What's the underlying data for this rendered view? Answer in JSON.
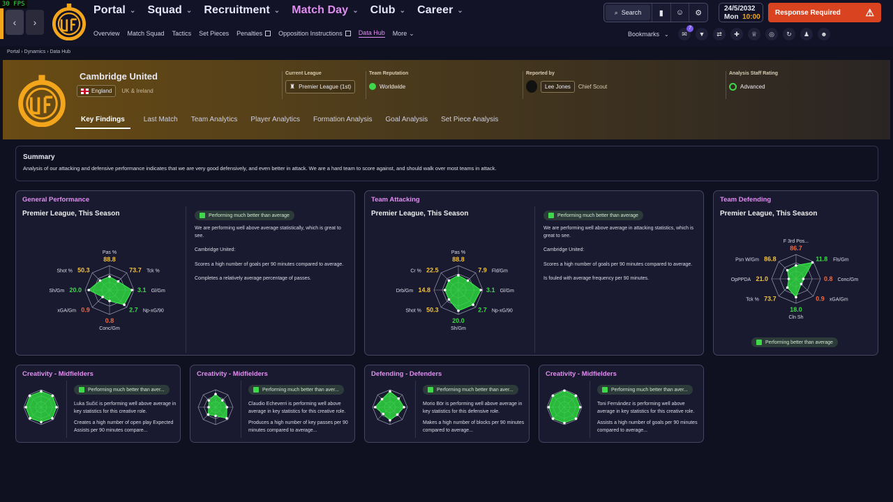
{
  "fps": "30 FPS",
  "nav": {
    "main": [
      "Portal",
      "Squad",
      "Recruitment",
      "Match Day",
      "Club",
      "Career"
    ],
    "active": "Match Day",
    "sub": [
      "Overview",
      "Match Squad",
      "Tactics",
      "Set Pieces",
      "Penalties",
      "Opposition Instructions",
      "Data Hub",
      "More"
    ],
    "sub_active": "Data Hub",
    "search_label": "Search",
    "date": "24/5/2032",
    "day": "Mon",
    "time": "10:00",
    "response": "Response Required",
    "bookmarks": "Bookmarks",
    "notif_count": "7"
  },
  "breadcrumb": [
    "Portal",
    "Dynamics",
    "Data Hub"
  ],
  "team": {
    "name": "Cambridge United",
    "nation": "England",
    "region": "UK & Ireland",
    "league_label": "Current League",
    "league": "Premier League (1st)",
    "rep_label": "Team Reputation",
    "rep": "Worldwide",
    "reported_label": "Reported by",
    "reporter": "Lee Jones",
    "reporter_role": "Chief Scout",
    "rating_label": "Analysis Staff Rating",
    "rating": "Advanced"
  },
  "tabs": [
    "Key Findings",
    "Last Match",
    "Team Analytics",
    "Player Analytics",
    "Formation Analysis",
    "Goal Analysis",
    "Set Piece Analysis"
  ],
  "summary": {
    "title": "Summary",
    "text": "Analysis of our attacking and defensive performance indicates that we are very good defensively, and even better in attack. We are a hard team to score against, and should walk over most teams in attack."
  },
  "colors": {
    "accent": "#e08ef0",
    "good": "#3ed84a",
    "mid": "#f3c23a",
    "bad": "#ec6a45",
    "brand": "#f3a51b"
  },
  "panels": [
    {
      "title": "General Performance",
      "sub": "Premier League, This Season",
      "pill": "Performing much better than average",
      "lines": [
        "We are performing well above average statistically, which is great to see.",
        "Cambridge United:",
        "Scores a high number of goals per 90 minutes compared to average.",
        "Completes a relatively average percentage of passes."
      ],
      "chart_data": {
        "type": "radar",
        "axes": [
          {
            "label": "Pas %",
            "value": "88.8",
            "level": 0.55,
            "color": "mid"
          },
          {
            "label": "Tck %",
            "value": "73.7",
            "level": 0.5,
            "color": "mid"
          },
          {
            "label": "Gl/Gm",
            "value": "3.1",
            "level": 0.92,
            "color": "good"
          },
          {
            "label": "Np-xG/90",
            "value": "2.7",
            "level": 0.85,
            "color": "good"
          },
          {
            "label": "Conc/Gm",
            "value": "0.8",
            "level": 0.45,
            "color": "bad"
          },
          {
            "label": "xGA/Gm",
            "value": "0.9",
            "level": 0.4,
            "color": "bad"
          },
          {
            "label": "Sh/Gm",
            "value": "20.0",
            "level": 0.85,
            "color": "good"
          },
          {
            "label": "Shot %",
            "value": "50.3",
            "level": 0.55,
            "color": "mid"
          }
        ]
      }
    },
    {
      "title": "Team Attacking",
      "sub": "Premier League, This Season",
      "pill": "Performing much better than average",
      "lines": [
        "We are performing well above average in attacking statistics, which is great to see.",
        "Cambridge United:",
        "Scores a high number of goals per 90 minutes compared to average.",
        "Is fouled with average frequency per 90 minutes."
      ],
      "chart_data": {
        "type": "radar",
        "axes": [
          {
            "label": "Pas %",
            "value": "88.8",
            "level": 0.6,
            "color": "mid"
          },
          {
            "label": "Fld/Gm",
            "value": "7.9",
            "level": 0.55,
            "color": "mid"
          },
          {
            "label": "Gl/Gm",
            "value": "3.1",
            "level": 0.92,
            "color": "good"
          },
          {
            "label": "Np-xG/90",
            "value": "2.7",
            "level": 0.85,
            "color": "good"
          },
          {
            "label": "Sh/Gm",
            "value": "20.0",
            "level": 0.85,
            "color": "good"
          },
          {
            "label": "Shot %",
            "value": "50.3",
            "level": 0.55,
            "color": "mid"
          },
          {
            "label": "Drb/Gm",
            "value": "14.8",
            "level": 0.55,
            "color": "mid"
          },
          {
            "label": "Cr %",
            "value": "22.5",
            "level": 0.55,
            "color": "mid"
          }
        ]
      }
    },
    {
      "title": "Team Defending",
      "sub": "Premier League, This Season",
      "pill": "Performing better than average",
      "chart_data": {
        "type": "radar",
        "axes": [
          {
            "label": "F 3rd Pos...",
            "value": "86.7",
            "level": 0.55,
            "color": "bad"
          },
          {
            "label": "Fls/Gm",
            "value": "11.8",
            "level": 0.95,
            "color": "good"
          },
          {
            "label": "Conc/Gm",
            "value": "0.8",
            "level": 0.3,
            "color": "bad"
          },
          {
            "label": "xGA/Gm",
            "value": "0.9",
            "level": 0.3,
            "color": "bad"
          },
          {
            "label": "Cln Sh",
            "value": "18.0",
            "level": 0.75,
            "color": "good"
          },
          {
            "label": "Tck %",
            "value": "73.7",
            "level": 0.5,
            "color": "mid"
          },
          {
            "label": "OpPPDA",
            "value": "21.0",
            "level": 0.3,
            "color": "mid"
          },
          {
            "label": "Psn W/Gm",
            "value": "86.8",
            "level": 0.5,
            "color": "mid"
          }
        ]
      }
    }
  ],
  "mini": [
    {
      "title": "Creativity - Midfielders",
      "pill": "Performing much better than aver...",
      "lines": [
        "Luka Sučić is performing well above average in key statistics for this creative role.",
        "Creates a high number of open play Expected Assists per 90 minutes compare..."
      ],
      "levels": [
        0.9,
        0.92,
        0.88,
        0.9,
        0.85,
        0.9,
        0.88,
        0.92
      ]
    },
    {
      "title": "Creativity - Midfielders",
      "pill": "Performing much better than aver...",
      "lines": [
        "Claudio Echeverri is performing well above average in key statistics for this creative role.",
        "Produces a high number of key passes per 90 minutes compared to average..."
      ],
      "levels": [
        0.75,
        0.55,
        0.65,
        0.9,
        0.5,
        0.6,
        0.4,
        0.55
      ]
    },
    {
      "title": "Defending - Defenders",
      "pill": "Performing much better than aver...",
      "lines": [
        "Morio Bör is performing well above average in key statistics for this defensive role.",
        "Makes a high number of blocks per 90 minutes compared to average..."
      ],
      "levels": [
        0.9,
        0.7,
        0.8,
        0.6,
        0.75,
        0.55,
        0.85,
        0.65
      ]
    },
    {
      "title": "Creativity - Midfielders",
      "pill": "Performing much better than aver...",
      "lines": [
        "Toni Fernández is performing well above average in key statistics for this creative role.",
        "Assists a high number of goals per 90 minutes compared to average..."
      ],
      "levels": [
        0.95,
        0.92,
        0.9,
        0.93,
        0.9,
        0.92,
        0.9,
        0.93
      ]
    }
  ]
}
